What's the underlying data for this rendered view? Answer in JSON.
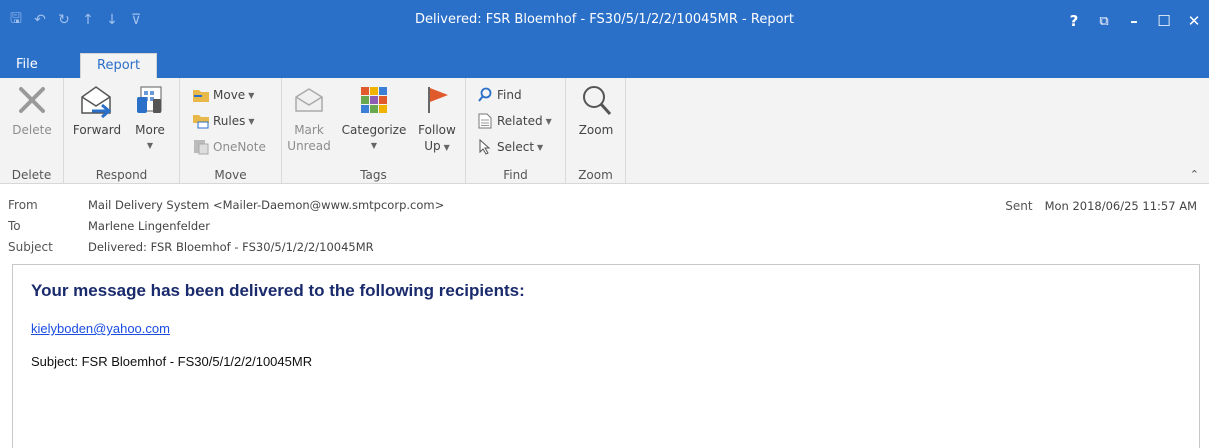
{
  "window": {
    "title": "Delivered: FSR Bloemhof - FS30/5/1/2/2/10045MR  - Report",
    "help": "?",
    "restore": "⧉",
    "minimize": "–",
    "maximize": "☐",
    "close": "✕"
  },
  "quick_access": {
    "save": "🖫",
    "undo": "↶",
    "redo": "↻",
    "up": "↑",
    "down": "↓",
    "customize": "⊽"
  },
  "tabs": {
    "file": "File",
    "report": "Report"
  },
  "ribbon": {
    "delete_group": {
      "label": "Delete",
      "delete_button": "Delete"
    },
    "respond_group": {
      "label": "Respond",
      "forward_button": "Forward",
      "more_button": "More"
    },
    "move_group": {
      "label": "Move",
      "move_button": "Move",
      "rules_button": "Rules",
      "onenote_button": "OneNote"
    },
    "tags_group": {
      "label": "Tags",
      "mark_unread_line1": "Mark",
      "mark_unread_line2": "Unread",
      "categorize_button": "Categorize",
      "follow_up_line1": "Follow",
      "follow_up_line2": "Up"
    },
    "find_group": {
      "label": "Find",
      "find_button": "Find",
      "related_button": "Related",
      "select_button": "Select"
    },
    "zoom_group": {
      "label": "Zoom",
      "zoom_button": "Zoom"
    }
  },
  "header": {
    "from_label": "From",
    "from_value": "Mail Delivery System <Mailer-Daemon@www.smtpcorp.com>",
    "to_label": "To",
    "to_value": "Marlene Lingenfelder",
    "subject_label": "Subject",
    "subject_value": "Delivered: FSR Bloemhof - FS30/5/1/2/2/10045MR",
    "sent_label": "Sent",
    "sent_value": "Mon 2018/06/25 11:57 AM"
  },
  "body": {
    "headline": "Your message has been delivered to the following recipients:",
    "recipient": "kielyboden@yahoo.com",
    "subject_line": "Subject: FSR Bloemhof - FS30/5/1/2/2/10045MR"
  },
  "colors": {
    "titlebar": "#2a6fc8",
    "ribbon": "#f3f3f3",
    "headline": "#1a2b6d",
    "link": "#1a4de0"
  }
}
